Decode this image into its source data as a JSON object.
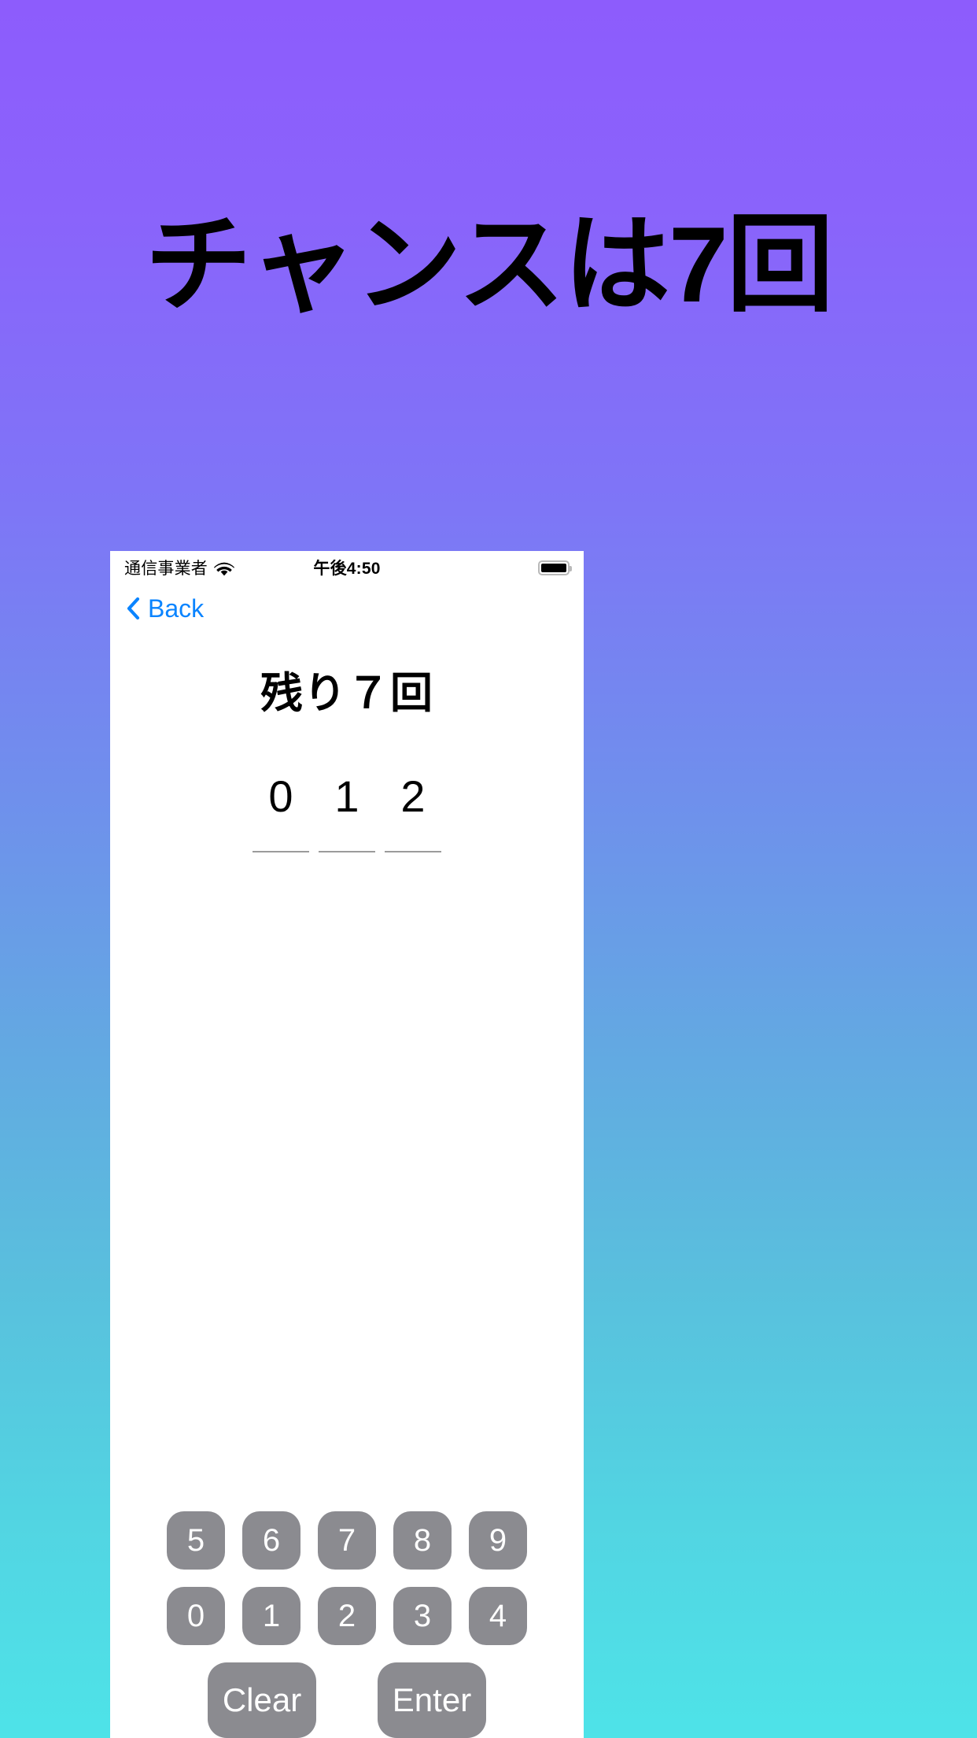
{
  "poster": {
    "title": "チャンスは7回",
    "background_top_color": "#8d5cfc",
    "background_bottom_color": "#4ee3e8"
  },
  "phone": {
    "status_bar": {
      "carrier": "通信事業者",
      "wifi_icon": "wifi-icon",
      "time": "午後4:50",
      "battery_icon": "battery-full-icon"
    },
    "nav_bar": {
      "back_label": "Back",
      "back_icon": "chevron-left-icon",
      "accent_color": "#0a84ff"
    },
    "heading": "残り７回",
    "guess_display": {
      "digits": [
        "0",
        "1",
        "2"
      ]
    },
    "keypad": {
      "row_one": [
        "5",
        "6",
        "7",
        "8",
        "9"
      ],
      "row_two": [
        "0",
        "1",
        "2",
        "3",
        "4"
      ],
      "clear_label": "Clear",
      "enter_label": "Enter",
      "key_color": "#8b8b90",
      "key_text_color": "#ffffff"
    }
  }
}
